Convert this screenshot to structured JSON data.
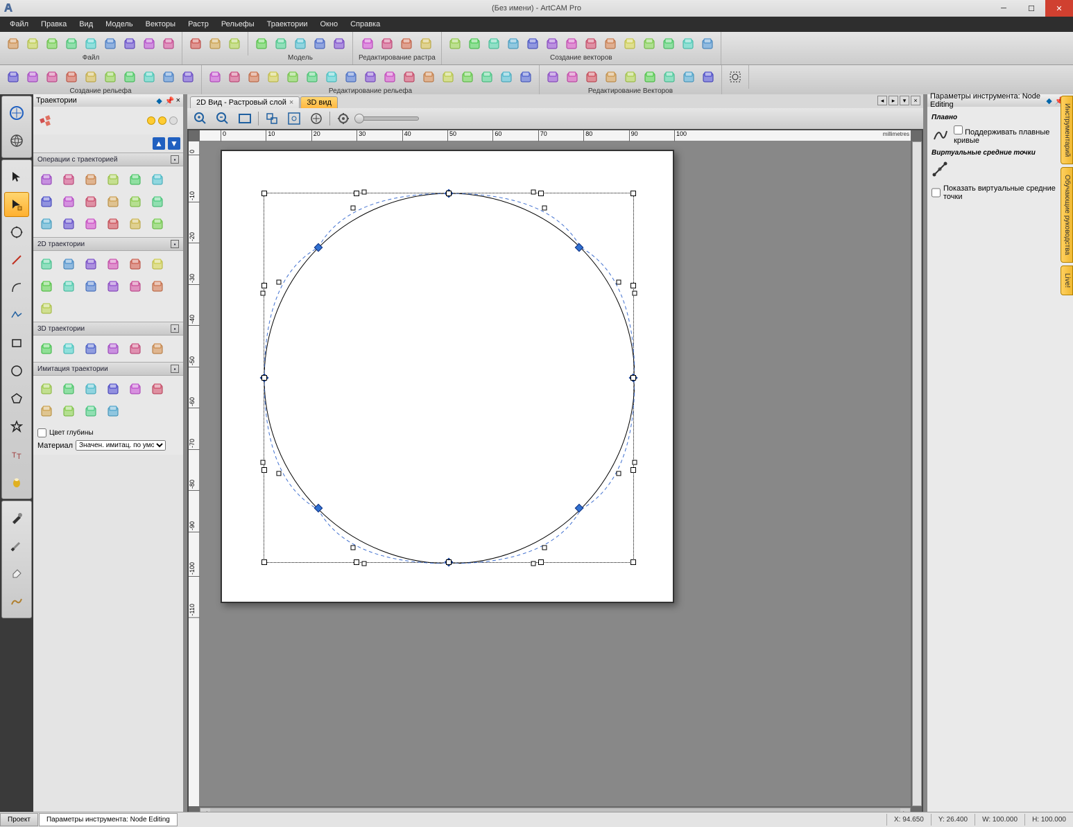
{
  "title": "(Без имени) - ArtCAM Pro",
  "menu": [
    "Файл",
    "Правка",
    "Вид",
    "Модель",
    "Векторы",
    "Растр",
    "Рельефы",
    "Траектории",
    "Окно",
    "Справка"
  ],
  "toolbar_groups": [
    {
      "label": "Файл",
      "count": 9
    },
    {
      "label": "",
      "count": 3
    },
    {
      "label": "Модель",
      "count": 5
    },
    {
      "label": "Редактирование растра",
      "count": 4
    },
    {
      "label": "Создание векторов",
      "count": 14
    }
  ],
  "toolbar2_groups": [
    {
      "label": "Создание рельефа",
      "count": 10
    },
    {
      "label": "Редактирование рельефа",
      "count": 17
    },
    {
      "label": "Редактирование Векторов",
      "count": 9
    }
  ],
  "traj_panel": {
    "title": "Траектории",
    "sections": [
      {
        "hdr": "Операции с траекторией",
        "icons": 18
      },
      {
        "hdr": "2D траектории",
        "icons": 13
      },
      {
        "hdr": "3D траектории",
        "icons": 6
      },
      {
        "hdr": "Имитация траектории",
        "icons": 10
      }
    ],
    "depth_color": "Цвет глубины",
    "material_label": "Материал",
    "material_value": "Значен. имитац. по умолч."
  },
  "tabs": {
    "tab1": "2D Вид - Растровый слой",
    "tab2": "3D вид"
  },
  "ruler_unit": "millimetres",
  "ruler_h": [
    "0",
    "10",
    "20",
    "30",
    "40",
    "50",
    "60",
    "70",
    "80",
    "90",
    "100"
  ],
  "ruler_v": [
    "0",
    "-10",
    "-20",
    "-30",
    "-40",
    "-50",
    "-60",
    "-70",
    "-80",
    "-90",
    "-100",
    "-110"
  ],
  "right_panel": {
    "title": "Параметры инструмента: Node Editing",
    "s1": "Плавно",
    "s1_check": "Поддерживать плавные кривые",
    "s2": "Виртуальные средние точки",
    "s2_check": "Показать виртуальные средние точки"
  },
  "side_tabs": [
    "Инструментарий",
    "Обучающие руководства",
    "Live!"
  ],
  "status_tabs": [
    "Проект",
    "Параметры инструмента: Node Editing"
  ],
  "status": {
    "x": "X: 94.650",
    "y": "Y: 26.400",
    "w": "W: 100.000",
    "h": "H: 100.000"
  },
  "colors": [
    "#000",
    "#000",
    "#fff",
    "#00cccc",
    "#0033cc",
    "#00aa00",
    "#cc0000",
    "#cc00cc",
    "#cccc00",
    "#808000",
    "#cc8800"
  ]
}
